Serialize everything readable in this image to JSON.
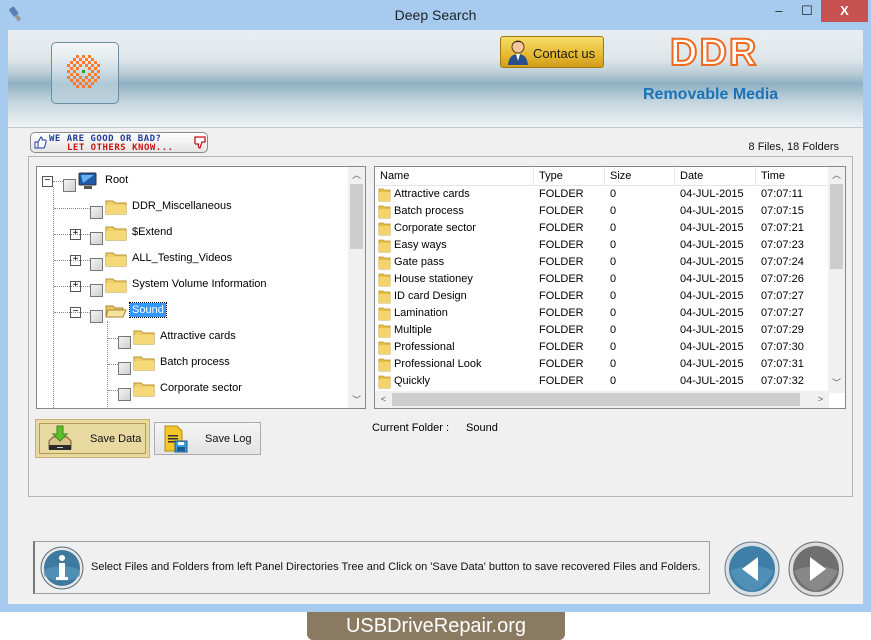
{
  "window": {
    "title": "Deep Search",
    "controls": {
      "minimize": "‒",
      "maximize": "☐",
      "close": "X"
    }
  },
  "banner": {
    "contact_label": "Contact us",
    "brand": "DDR",
    "product": "Removable Media"
  },
  "feedback": {
    "line1": "WE ARE GOOD OR BAD?",
    "line2": "LET OTHERS KNOW..."
  },
  "summary": {
    "counts": "8 Files, 18 Folders"
  },
  "tree": {
    "root": "Root",
    "nodes": [
      {
        "label": "DDR_Miscellaneous",
        "expander": ""
      },
      {
        "label": "$Extend",
        "expander": "+"
      },
      {
        "label": "ALL_Testing_Videos",
        "expander": "+"
      },
      {
        "label": "System Volume Information",
        "expander": "+"
      },
      {
        "label": "Sound",
        "expander": "−",
        "selected": true
      }
    ],
    "children": [
      "Attractive cards",
      "Batch process",
      "Corporate sector"
    ]
  },
  "list": {
    "columns": [
      "Name",
      "Type",
      "Size",
      "Date",
      "Time"
    ],
    "rows": [
      {
        "name": "Attractive cards",
        "type": "FOLDER",
        "size": "0",
        "date": "04-JUL-2015",
        "time": "07:07:11"
      },
      {
        "name": "Batch process",
        "type": "FOLDER",
        "size": "0",
        "date": "04-JUL-2015",
        "time": "07:07:15"
      },
      {
        "name": "Corporate sector",
        "type": "FOLDER",
        "size": "0",
        "date": "04-JUL-2015",
        "time": "07:07:21"
      },
      {
        "name": "Easy ways",
        "type": "FOLDER",
        "size": "0",
        "date": "04-JUL-2015",
        "time": "07:07:23"
      },
      {
        "name": "Gate pass",
        "type": "FOLDER",
        "size": "0",
        "date": "04-JUL-2015",
        "time": "07:07:24"
      },
      {
        "name": "House stationey",
        "type": "FOLDER",
        "size": "0",
        "date": "04-JUL-2015",
        "time": "07:07:26"
      },
      {
        "name": "ID card Design",
        "type": "FOLDER",
        "size": "0",
        "date": "04-JUL-2015",
        "time": "07:07:27"
      },
      {
        "name": "Lamination",
        "type": "FOLDER",
        "size": "0",
        "date": "04-JUL-2015",
        "time": "07:07:27"
      },
      {
        "name": "Multiple",
        "type": "FOLDER",
        "size": "0",
        "date": "04-JUL-2015",
        "time": "07:07:29"
      },
      {
        "name": "Professional",
        "type": "FOLDER",
        "size": "0",
        "date": "04-JUL-2015",
        "time": "07:07:30"
      },
      {
        "name": "Professional Look",
        "type": "FOLDER",
        "size": "0",
        "date": "04-JUL-2015",
        "time": "07:07:31"
      },
      {
        "name": "Quickly",
        "type": "FOLDER",
        "size": "0",
        "date": "04-JUL-2015",
        "time": "07:07:32"
      }
    ]
  },
  "actions": {
    "save_data": "Save Data",
    "save_log": "Save Log"
  },
  "current_folder": {
    "label": "Current Folder :",
    "value": "Sound"
  },
  "info": {
    "message": "Select Files and Folders from left Panel Directories Tree and Click on 'Save Data' button to save recovered Files and Folders."
  },
  "watermark": "USBDriveRepair.org"
}
